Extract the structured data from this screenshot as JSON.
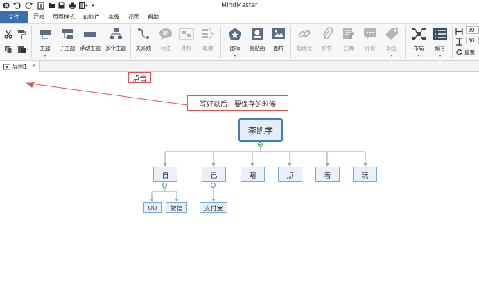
{
  "app": {
    "title": "MindMaster"
  },
  "quick_access": [
    "app-logo-icon",
    "undo-icon",
    "redo-icon",
    "new-icon",
    "open-icon",
    "save-icon",
    "print-icon",
    "export-icon",
    "customize-icon"
  ],
  "menu": {
    "file": "文件",
    "items": [
      "开始",
      "页面样式",
      "幻灯片",
      "高级",
      "视图",
      "帮助"
    ]
  },
  "ribbon": {
    "topic": "主题",
    "subtopic": "子主题",
    "floating_topic": "浮动主题",
    "multi_topic": "多个主题",
    "relationship": "关系线",
    "callout": "标注",
    "boundary": "外框",
    "summary": "概要",
    "icon": "图标",
    "clipart": "剪贴画",
    "picture": "图片",
    "hyperlink": "超链接",
    "attachment": "附件",
    "note": "注释",
    "comment": "评论",
    "tag": "标签",
    "layout": "布局",
    "numbering": "编号",
    "spacing_h": "30",
    "spacing_v": "30",
    "reset": "重置"
  },
  "tab": {
    "name": "导图1"
  },
  "annotations": {
    "click": "点击",
    "save_hint": "写好以后，要保存的时候"
  },
  "mindmap": {
    "root": "李凯学",
    "children": [
      "自",
      "己",
      "瞎",
      "点",
      "着",
      "玩"
    ],
    "zi_children": [
      "QQ",
      "微信"
    ],
    "ji_children": [
      "支付宝"
    ]
  },
  "colors": {
    "file_menu": "#3c6fae",
    "node_border": "#7aa9d6",
    "node_fill": "#e8f1fa",
    "root_border": "#3f7fb6",
    "annotation_red": "#e05252",
    "collapse_green": "#3aa64a"
  }
}
